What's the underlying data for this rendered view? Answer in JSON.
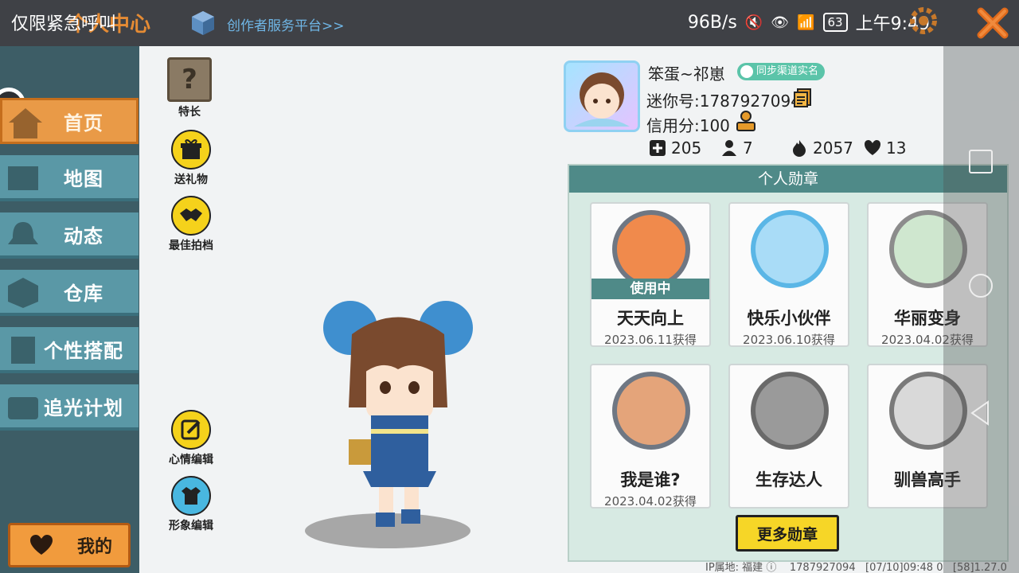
{
  "header": {
    "title": "个人中心",
    "emergency": "仅限紧急呼叫",
    "creator_link": "创作者服务平台>>"
  },
  "status_bar": {
    "speed": "96B/s",
    "battery": "63",
    "time": "上午9:49"
  },
  "sidebar": {
    "items": [
      {
        "label": "首页",
        "icon": "house-icon"
      },
      {
        "label": "地图",
        "icon": "map-icon"
      },
      {
        "label": "动态",
        "icon": "bell-icon"
      },
      {
        "label": "仓库",
        "icon": "box-icon"
      },
      {
        "label": "个性搭配",
        "icon": "figure-icon"
      },
      {
        "label": "追光计划",
        "icon": "film-icon"
      }
    ],
    "mine": "我的"
  },
  "tools": {
    "specialty": "特长",
    "gift": "送礼物",
    "partner": "最佳拍档",
    "mood": "心情编辑",
    "appearance": "形象编辑",
    "question_mark": "?"
  },
  "profile": {
    "nickname": "笨蛋~祁崽",
    "verify": "同步渠道实名",
    "uid": "迷你号:1787927094",
    "credit": "信用分:100",
    "stats": {
      "likes": "205",
      "fans": "7",
      "heat": "2057",
      "hearts": "13"
    }
  },
  "medals": {
    "title": "个人勋章",
    "in_use": "使用中",
    "items": [
      {
        "name": "天天向上",
        "date": "2023.06.11获得"
      },
      {
        "name": "快乐小伙伴",
        "date": "2023.06.10获得"
      },
      {
        "name": "华丽变身",
        "date": "2023.04.02获得"
      },
      {
        "name": "我是谁?",
        "date": "2023.04.02获得"
      },
      {
        "name": "生存达人",
        "date": ""
      },
      {
        "name": "驯兽高手",
        "date": ""
      }
    ],
    "more": "更多勋章"
  },
  "footer": {
    "ip": "IP属地: 福建",
    "uid": "1787927094",
    "time": "[07/10]09:48 0",
    "version": "[58]1.27.0"
  },
  "colors": {
    "accent": "#e99a47",
    "sidebar": "#5a98a6",
    "medal_header": "#4f8a88",
    "more_button": "#f6d627"
  }
}
